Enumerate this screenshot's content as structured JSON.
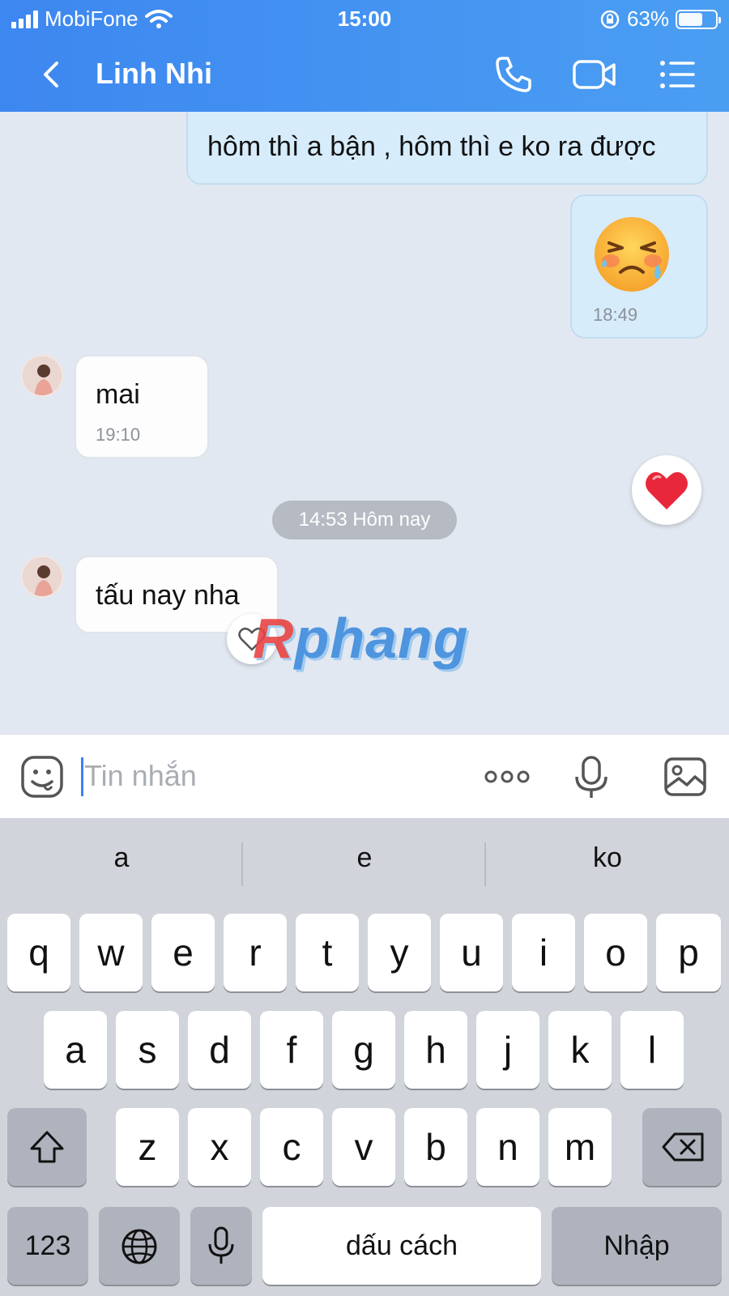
{
  "status": {
    "carrier": "MobiFone",
    "time": "15:00",
    "battery": "63%"
  },
  "header": {
    "title": "Linh Nhi"
  },
  "messages": {
    "out1": "hôm thì a bận , hôm thì e ko ra được",
    "out2_time": "18:49",
    "in1_text": "mai",
    "in1_time": "19:10",
    "divider": "14:53 Hôm nay",
    "in2_text": "tấu nay nha"
  },
  "watermark": {
    "first": "R",
    "rest": "phang"
  },
  "input": {
    "placeholder": "Tin nhắn"
  },
  "keyboard": {
    "suggestions": [
      "a",
      "e",
      "ko"
    ],
    "row1": [
      "q",
      "w",
      "e",
      "r",
      "t",
      "y",
      "u",
      "i",
      "o",
      "p"
    ],
    "row2": [
      "a",
      "s",
      "d",
      "f",
      "g",
      "h",
      "j",
      "k",
      "l"
    ],
    "row3": [
      "z",
      "x",
      "c",
      "v",
      "b",
      "n",
      "m"
    ],
    "num_label": "123",
    "space_label": "dấu cách",
    "return_label": "Nhập"
  },
  "icons": {
    "back": "chevron-left-icon",
    "phone": "phone-icon",
    "video": "video-icon",
    "menu": "list-icon",
    "sticker": "sticker-icon",
    "more": "more-icon",
    "mic": "microphone-icon",
    "image": "image-icon",
    "shift": "shift-icon",
    "backspace": "backspace-icon",
    "globe": "globe-icon",
    "dictation": "dictation-icon"
  },
  "colors": {
    "header": "#3d87f0",
    "outgoing_bubble": "#d6ecfb",
    "incoming_bubble": "#fdfdfd",
    "chat_bg": "#e2e8f1",
    "heart": "#e8283a"
  }
}
